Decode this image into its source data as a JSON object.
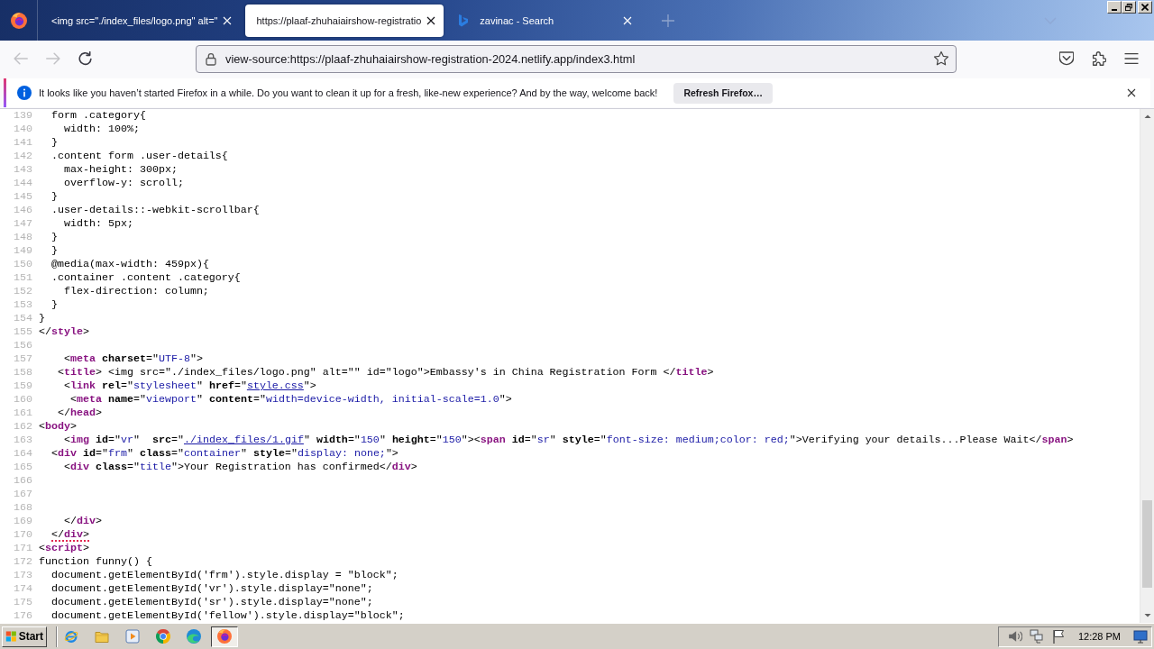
{
  "window": {
    "tabs": [
      {
        "title": "<img src=\"./index_files/logo.png\" alt=\"",
        "selected": false,
        "favicon": false
      },
      {
        "title": "https://plaaf-zhuhaiairshow-registratio",
        "selected": true,
        "favicon": false
      },
      {
        "title": "zavinac - Search",
        "selected": false,
        "favicon": true
      }
    ]
  },
  "toolbar": {
    "nav_buttons": [
      {
        "kind": "back",
        "disabled": true
      },
      {
        "kind": "forward",
        "disabled": true
      },
      {
        "kind": "reload",
        "disabled": false
      }
    ],
    "address": "view-source:https://plaaf-zhuhaiairshow-registration-2024.netlify.app/index3.html"
  },
  "notification": {
    "message": "It looks like you haven’t started Firefox in a while. Do you want to clean it up for a fresh, like-new experience? And by the way, welcome back!",
    "button": "Refresh Firefox…"
  },
  "source": {
    "lines": [
      {
        "number": "139",
        "error": false,
        "tokens": [
          {
            "kind": "text",
            "text": "  form .category{"
          }
        ]
      },
      {
        "number": "140",
        "error": false,
        "tokens": [
          {
            "kind": "text",
            "text": "    width: 100%;"
          }
        ]
      },
      {
        "number": "141",
        "error": false,
        "tokens": [
          {
            "kind": "text",
            "text": "  }"
          }
        ]
      },
      {
        "number": "142",
        "error": false,
        "tokens": [
          {
            "kind": "text",
            "text": "  .content form .user-details{"
          }
        ]
      },
      {
        "number": "143",
        "error": false,
        "tokens": [
          {
            "kind": "text",
            "text": "    max-height: 300px;"
          }
        ]
      },
      {
        "number": "144",
        "error": false,
        "tokens": [
          {
            "kind": "text",
            "text": "    overflow-y: scroll;"
          }
        ]
      },
      {
        "number": "145",
        "error": false,
        "tokens": [
          {
            "kind": "text",
            "text": "  }"
          }
        ]
      },
      {
        "number": "146",
        "error": false,
        "tokens": [
          {
            "kind": "text",
            "text": "  .user-details::-webkit-scrollbar{"
          }
        ]
      },
      {
        "number": "147",
        "error": false,
        "tokens": [
          {
            "kind": "text",
            "text": "    width: 5px;"
          }
        ]
      },
      {
        "number": "148",
        "error": false,
        "tokens": [
          {
            "kind": "text",
            "text": "  }"
          }
        ]
      },
      {
        "number": "149",
        "error": false,
        "tokens": [
          {
            "kind": "text",
            "text": "  }"
          }
        ]
      },
      {
        "number": "150",
        "error": false,
        "tokens": [
          {
            "kind": "text",
            "text": "  @media(max-width: 459px){"
          }
        ]
      },
      {
        "number": "151",
        "error": false,
        "tokens": [
          {
            "kind": "text",
            "text": "  .container .content .category{"
          }
        ]
      },
      {
        "number": "152",
        "error": false,
        "tokens": [
          {
            "kind": "text",
            "text": "    flex-direction: column;"
          }
        ]
      },
      {
        "number": "153",
        "error": false,
        "tokens": [
          {
            "kind": "text",
            "text": "  }"
          }
        ]
      },
      {
        "number": "154",
        "error": false,
        "tokens": [
          {
            "kind": "text",
            "text": "}"
          }
        ]
      },
      {
        "number": "155",
        "error": false,
        "tokens": [
          {
            "kind": "text",
            "text": "</"
          },
          {
            "kind": "tag",
            "text": "style"
          },
          {
            "kind": "text",
            "text": ">"
          }
        ]
      },
      {
        "number": "156"
      },
      {
        "number": "157",
        "error": false,
        "tokens": [
          {
            "kind": "text",
            "text": "    <"
          },
          {
            "kind": "tag",
            "text": "meta"
          },
          {
            "kind": "attr",
            "text": " charset"
          },
          {
            "kind": "text",
            "text": "=\""
          },
          {
            "kind": "value",
            "text": "UTF-8"
          },
          {
            "kind": "text",
            "text": "\">"
          }
        ]
      },
      {
        "number": "158",
        "error": false,
        "tokens": [
          {
            "kind": "text",
            "text": "   <"
          },
          {
            "kind": "tag",
            "text": "title"
          },
          {
            "kind": "text",
            "text": "> <img src=\"./index_files/logo.png\" alt=\"\" id=\"logo\">Embassy's in China Registration Form </"
          },
          {
            "kind": "tag",
            "text": "title"
          },
          {
            "kind": "text",
            "text": ">"
          }
        ]
      },
      {
        "number": "159",
        "error": false,
        "tokens": [
          {
            "kind": "text",
            "text": "    <"
          },
          {
            "kind": "tag",
            "text": "link"
          },
          {
            "kind": "attr",
            "text": " rel"
          },
          {
            "kind": "text",
            "text": "=\""
          },
          {
            "kind": "value",
            "text": "stylesheet"
          },
          {
            "kind": "text",
            "text": "\" "
          },
          {
            "kind": "attr",
            "text": "href"
          },
          {
            "kind": "text",
            "text": "=\""
          },
          {
            "kind": "link",
            "text": "style.css"
          },
          {
            "kind": "text",
            "text": "\">"
          }
        ]
      },
      {
        "number": "160",
        "error": false,
        "tokens": [
          {
            "kind": "text",
            "text": "     <"
          },
          {
            "kind": "tag",
            "text": "meta"
          },
          {
            "kind": "attr",
            "text": " name"
          },
          {
            "kind": "text",
            "text": "=\""
          },
          {
            "kind": "value",
            "text": "viewport"
          },
          {
            "kind": "text",
            "text": "\" "
          },
          {
            "kind": "attr",
            "text": "content"
          },
          {
            "kind": "text",
            "text": "=\""
          },
          {
            "kind": "value",
            "text": "width=device-width, initial-scale=1.0"
          },
          {
            "kind": "text",
            "text": "\">"
          }
        ]
      },
      {
        "number": "161",
        "error": false,
        "tokens": [
          {
            "kind": "text",
            "text": "   </"
          },
          {
            "kind": "tag",
            "text": "head"
          },
          {
            "kind": "text",
            "text": ">"
          }
        ]
      },
      {
        "number": "162",
        "error": false,
        "tokens": [
          {
            "kind": "text",
            "text": "<"
          },
          {
            "kind": "tag",
            "text": "body"
          },
          {
            "kind": "text",
            "text": ">"
          }
        ]
      },
      {
        "number": "163",
        "error": false,
        "tokens": [
          {
            "kind": "text",
            "text": "    <"
          },
          {
            "kind": "tag",
            "text": "img"
          },
          {
            "kind": "attr",
            "text": " id"
          },
          {
            "kind": "text",
            "text": "=\""
          },
          {
            "kind": "value",
            "text": "vr"
          },
          {
            "kind": "text",
            "text": "\"  "
          },
          {
            "kind": "attr",
            "text": "src"
          },
          {
            "kind": "text",
            "text": "=\""
          },
          {
            "kind": "link",
            "text": "./index_files/1.gif"
          },
          {
            "kind": "text",
            "text": "\" "
          },
          {
            "kind": "attr",
            "text": "width"
          },
          {
            "kind": "text",
            "text": "=\""
          },
          {
            "kind": "value",
            "text": "150"
          },
          {
            "kind": "text",
            "text": "\" "
          },
          {
            "kind": "attr",
            "text": "height"
          },
          {
            "kind": "text",
            "text": "=\""
          },
          {
            "kind": "value",
            "text": "150"
          },
          {
            "kind": "text",
            "text": "\"><"
          },
          {
            "kind": "tag",
            "text": "span"
          },
          {
            "kind": "attr",
            "text": " id"
          },
          {
            "kind": "text",
            "text": "=\""
          },
          {
            "kind": "value",
            "text": "sr"
          },
          {
            "kind": "text",
            "text": "\" "
          },
          {
            "kind": "attr",
            "text": "style"
          },
          {
            "kind": "text",
            "text": "=\""
          },
          {
            "kind": "value",
            "text": "font-size: medium;color: red;"
          },
          {
            "kind": "text",
            "text": "\">Verifying your details...Please Wait</"
          },
          {
            "kind": "tag",
            "text": "span"
          },
          {
            "kind": "text",
            "text": ">"
          }
        ]
      },
      {
        "number": "164",
        "error": false,
        "tokens": [
          {
            "kind": "text",
            "text": "  <"
          },
          {
            "kind": "tag",
            "text": "div"
          },
          {
            "kind": "attr",
            "text": " id"
          },
          {
            "kind": "text",
            "text": "=\""
          },
          {
            "kind": "value",
            "text": "frm"
          },
          {
            "kind": "text",
            "text": "\" "
          },
          {
            "kind": "attr",
            "text": "class"
          },
          {
            "kind": "text",
            "text": "=\""
          },
          {
            "kind": "value",
            "text": "container"
          },
          {
            "kind": "text",
            "text": "\" "
          },
          {
            "kind": "attr",
            "text": "style"
          },
          {
            "kind": "text",
            "text": "=\""
          },
          {
            "kind": "value",
            "text": "display: none;"
          },
          {
            "kind": "text",
            "text": "\">"
          }
        ]
      },
      {
        "number": "165",
        "error": false,
        "tokens": [
          {
            "kind": "text",
            "text": "    <"
          },
          {
            "kind": "tag",
            "text": "div"
          },
          {
            "kind": "attr",
            "text": " class"
          },
          {
            "kind": "text",
            "text": "=\""
          },
          {
            "kind": "value",
            "text": "title"
          },
          {
            "kind": "text",
            "text": "\">Your Registration has confirmed</"
          },
          {
            "kind": "tag",
            "text": "div"
          },
          {
            "kind": "text",
            "text": ">"
          }
        ]
      },
      {
        "number": "166"
      },
      {
        "number": "167"
      },
      {
        "number": "168"
      },
      {
        "number": "169",
        "error": false,
        "tokens": [
          {
            "kind": "text",
            "text": "    </"
          },
          {
            "kind": "tag",
            "text": "div"
          },
          {
            "kind": "text",
            "text": ">"
          }
        ]
      },
      {
        "number": "170",
        "error": true,
        "tokens": [
          {
            "kind": "text",
            "text": "  </"
          },
          {
            "kind": "tag",
            "text": "div"
          },
          {
            "kind": "text",
            "text": ">"
          }
        ]
      },
      {
        "number": "171",
        "error": false,
        "tokens": [
          {
            "kind": "text",
            "text": "<"
          },
          {
            "kind": "tag",
            "text": "script"
          },
          {
            "kind": "text",
            "text": ">"
          }
        ]
      },
      {
        "number": "172",
        "error": false,
        "tokens": [
          {
            "kind": "text",
            "text": "function funny() {"
          }
        ]
      },
      {
        "number": "173",
        "error": false,
        "tokens": [
          {
            "kind": "text",
            "text": "  document.getElementById('frm').style.display = \"block\";"
          }
        ]
      },
      {
        "number": "174",
        "error": false,
        "tokens": [
          {
            "kind": "text",
            "text": "  document.getElementById('vr').style.display=\"none\";"
          }
        ]
      },
      {
        "number": "175",
        "error": false,
        "tokens": [
          {
            "kind": "text",
            "text": "  document.getElementById('sr').style.display=\"none\";"
          }
        ]
      },
      {
        "number": "176",
        "error": false,
        "tokens": [
          {
            "kind": "text",
            "text": "  document.getElementById('fellow').style.display=\"block\";"
          }
        ]
      }
    ]
  },
  "taskbar": {
    "start": "Start",
    "apps": [
      {
        "kind": "ie",
        "selected": false
      },
      {
        "kind": "folder",
        "selected": false
      },
      {
        "kind": "media",
        "selected": false
      },
      {
        "kind": "chrome",
        "selected": false
      },
      {
        "kind": "edge",
        "selected": false
      },
      {
        "kind": "firefox",
        "selected": true
      }
    ],
    "clock": "12:28 PM"
  }
}
